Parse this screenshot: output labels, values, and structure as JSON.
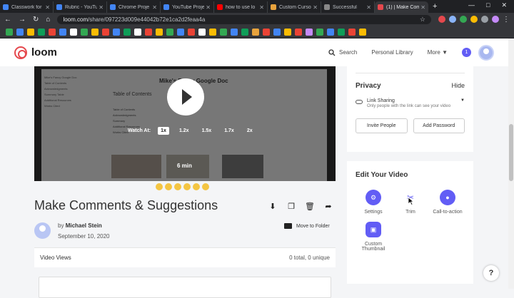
{
  "browser": {
    "tabs": [
      {
        "label": "Classwork for",
        "color": "#4285f4",
        "active": false
      },
      {
        "label": "Rubric - YouTu",
        "color": "#4285f4",
        "active": false
      },
      {
        "label": "Chrome Proje",
        "color": "#4285f4",
        "active": false
      },
      {
        "label": "YouTube Proje",
        "color": "#4285f4",
        "active": false
      },
      {
        "label": "how to use lo",
        "color": "#ff0000",
        "active": false
      },
      {
        "label": "Custom Cursor",
        "color": "#e8a33d",
        "active": false
      },
      {
        "label": "Successful",
        "color": "#888888",
        "active": false
      },
      {
        "label": "(1) | Make Com",
        "color": "#e5484d",
        "active": true
      }
    ],
    "new_tab": "+",
    "url_domain": "loom.com",
    "url_path": "/share/097223d009e44042b72e1ca2d2feaa4a"
  },
  "loom": {
    "logo": "loom",
    "search_label": "Search",
    "personal_library": "Personal Library",
    "more": "More",
    "notification_count": "1"
  },
  "video": {
    "doc_title": "Mike's Fancy Google Doc",
    "toc_title": "Table of Contents",
    "sidebar_items": [
      "Mike's Fancy Google Doc",
      "Table of Contents",
      "Acknowledgments",
      "Summary Table",
      "Additional Resources",
      "Works Cited"
    ],
    "toc_items": [
      "Table of Contents",
      "Acknowledgments",
      "Summary",
      "Additional Resources",
      "Works Cited"
    ],
    "watch_at": "Watch At:",
    "speeds": [
      "1x",
      "1.2x",
      "1.5x",
      "1.7x",
      "2x"
    ],
    "selected_speed": "1x",
    "duration": "6 min"
  },
  "meta": {
    "title": "Make Comments & Suggestions",
    "by": "by",
    "author": "Michael Stein",
    "date": "September 10, 2020",
    "move_to_folder": "Move to Folder",
    "views_label": "Video Views",
    "views_count": "0 total, 0 unique"
  },
  "privacy": {
    "title": "Privacy",
    "hide": "Hide",
    "link_sharing": "Link Sharing",
    "link_desc": "Only people with the link can see your video",
    "invite": "Invite People",
    "add_password": "Add Password"
  },
  "edit": {
    "title": "Edit Your Video",
    "tools": [
      {
        "label": "Settings",
        "icon": "gear-icon",
        "color": "#625df5"
      },
      {
        "label": "Trim",
        "icon": "scissors-icon",
        "color": "#ffffff"
      },
      {
        "label": "Call-to-action",
        "icon": "cta-icon",
        "color": "#625df5"
      },
      {
        "label": "Custom Thumbnail",
        "icon": "image-icon",
        "color": "#625df5"
      }
    ]
  },
  "help": "?"
}
